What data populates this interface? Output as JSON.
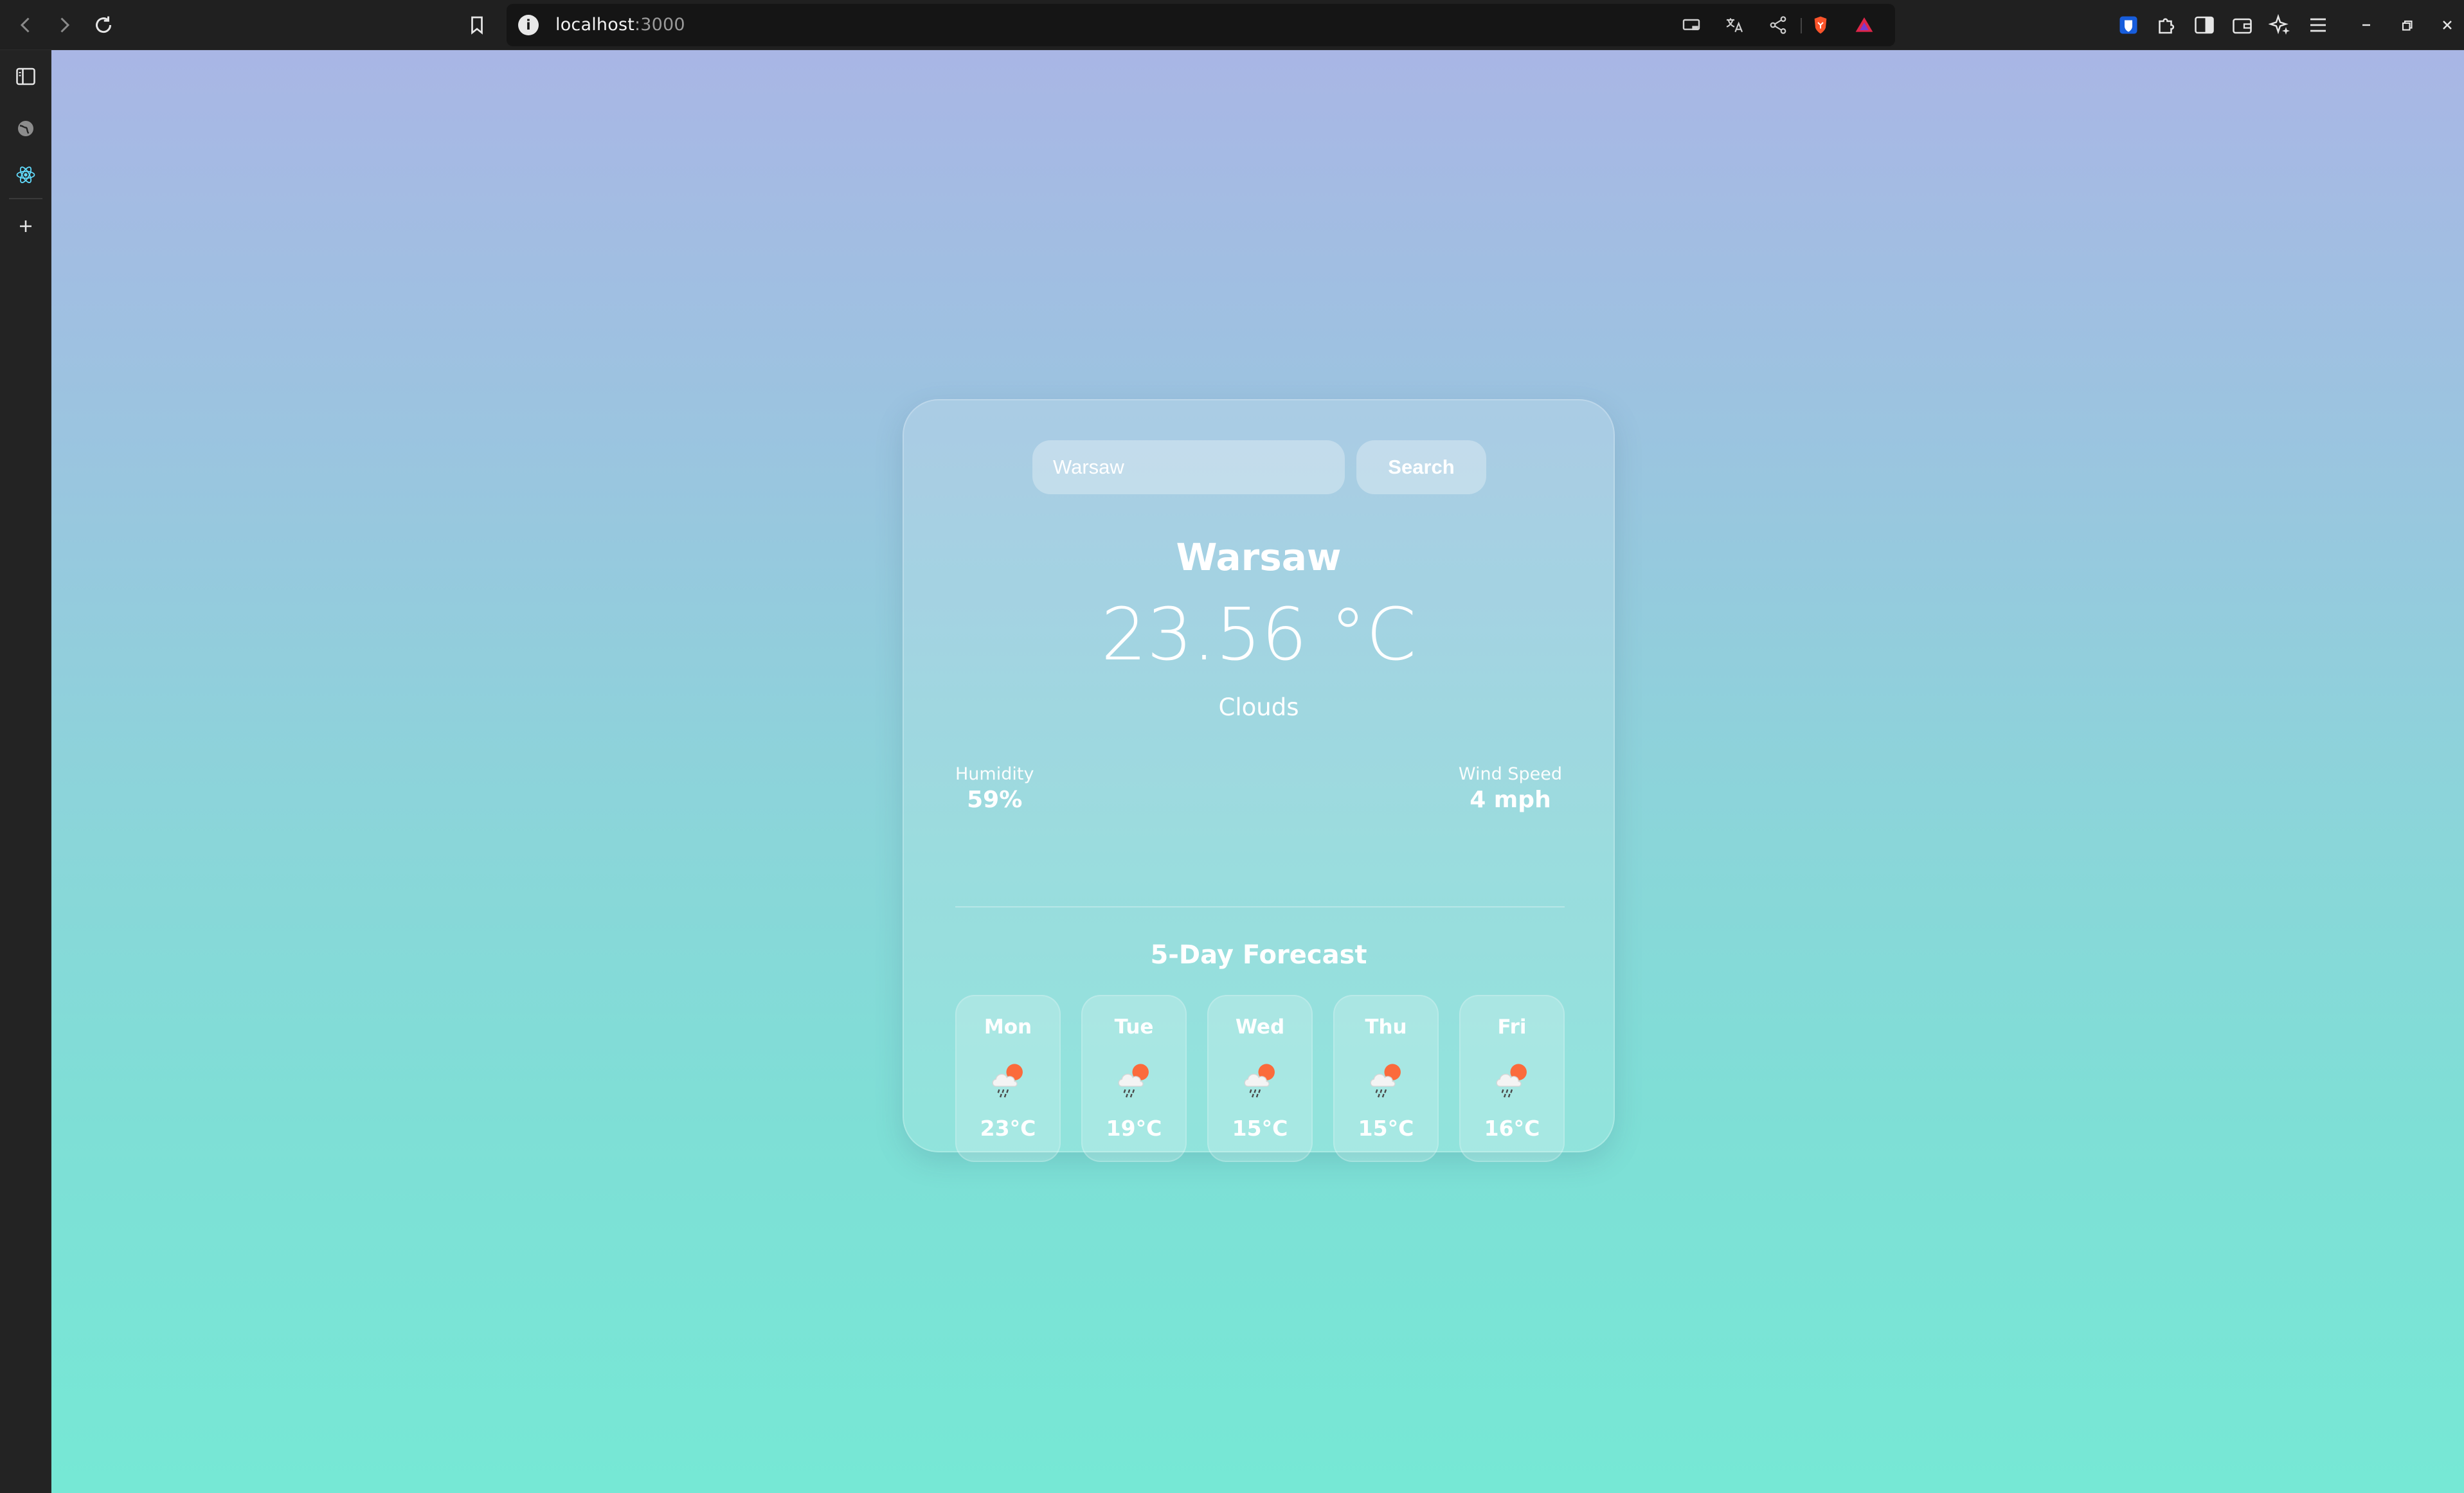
{
  "browser": {
    "url_host": "localhost",
    "url_port": ":3000"
  },
  "search": {
    "input_value": "Warsaw",
    "button_label": "Search"
  },
  "weather": {
    "city": "Warsaw",
    "temperature": "23.56 °C",
    "condition": "Clouds",
    "humidity_label": "Humidity",
    "humidity_value": "59%",
    "wind_label": "Wind Speed",
    "wind_value": "4 mph"
  },
  "forecast": {
    "title": "5-Day Forecast",
    "icon": "cloud-sun-rain-icon",
    "days": [
      {
        "day": "Mon",
        "temp": "23°C"
      },
      {
        "day": "Tue",
        "temp": "19°C"
      },
      {
        "day": "Wed",
        "temp": "15°C"
      },
      {
        "day": "Thu",
        "temp": "15°C"
      },
      {
        "day": "Fri",
        "temp": "16°C"
      }
    ]
  },
  "colors": {
    "gradient_top": "#a9b6e5",
    "gradient_bottom": "#76e8d5",
    "chrome_bg": "#202020",
    "brave_orange": "#fb542b"
  }
}
